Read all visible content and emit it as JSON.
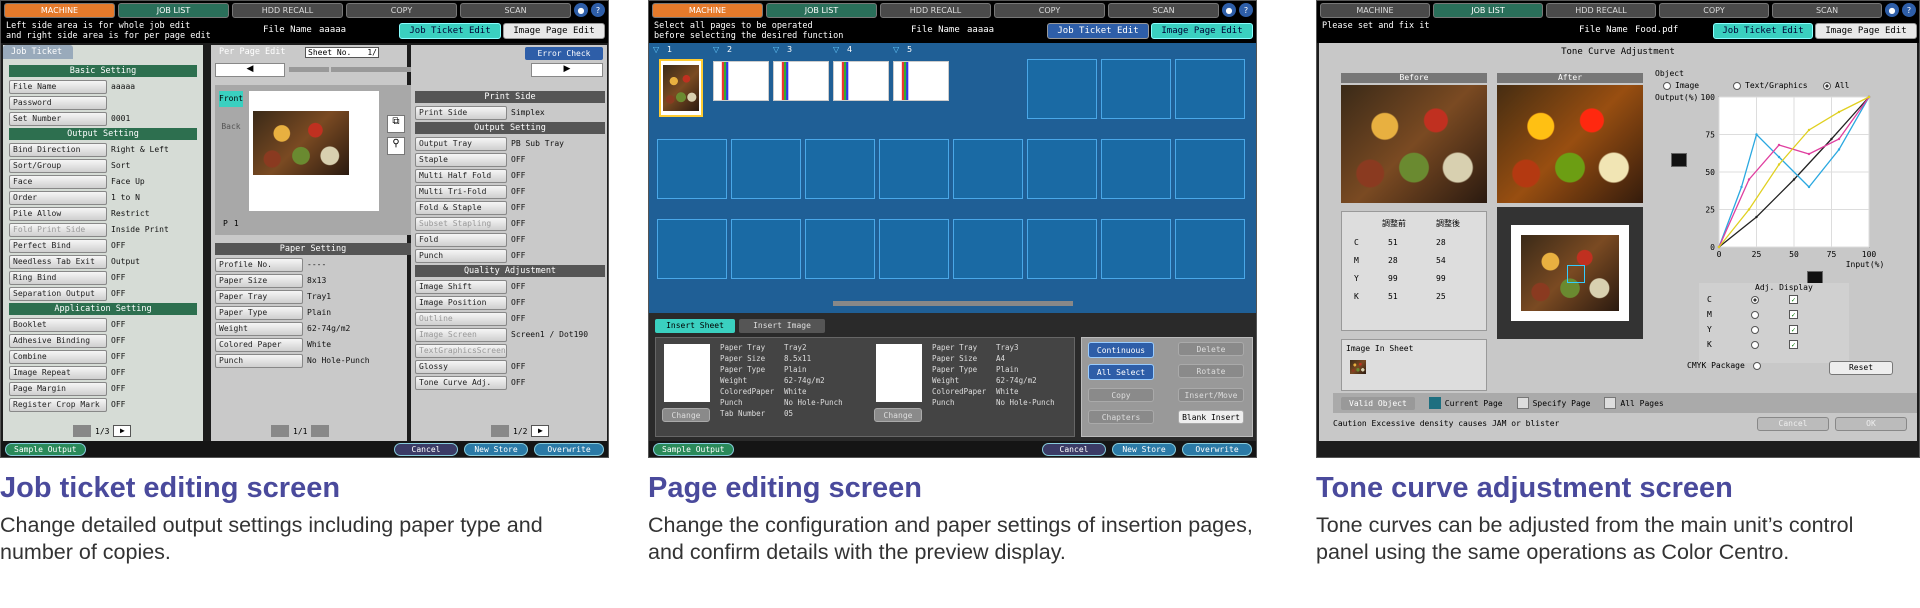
{
  "colors": {
    "machine_tab": "#e57a2b",
    "job_list_tab": "#2a6f5a",
    "accent_teal": "#3ad0c0",
    "section_green": "#2d6f4f",
    "caption_title": "#4a4a9c"
  },
  "topbar": {
    "machine": "MACHINE",
    "job_list": "JOB LIST",
    "hdd_recall": "HDD RECALL",
    "copy": "COPY",
    "scan": "SCAN",
    "help": "?"
  },
  "panel1": {
    "instr1": "Left side area is for whole job edit",
    "instr2": "and right side area is for per page edit",
    "file_name_label": "File Name",
    "file_name": "aaaaa",
    "tab_job_ticket": "Job Ticket Edit",
    "tab_image_page": "Image Page Edit",
    "job_ticket_tab": "Job Ticket",
    "per_page_edit": "Per Page Edit",
    "sheet_no_label": "Sheet No.",
    "sheet_no": "1/",
    "error_check": "Error Check",
    "front": "Front",
    "back": "Back",
    "page_label": "P",
    "page_num": "1",
    "basic_setting": "Basic Setting",
    "basic_rows": [
      {
        "label": "File Name",
        "value": "aaaaa"
      },
      {
        "label": "Password",
        "value": ""
      },
      {
        "label": "Set Number",
        "value": "0001"
      }
    ],
    "output_setting": "Output Setting",
    "output_rows": [
      {
        "label": "Bind Direction",
        "value": "Right & Left"
      },
      {
        "label": "Sort/Group",
        "value": "Sort"
      },
      {
        "label": "Face",
        "value": "Face Up"
      },
      {
        "label": "Order",
        "value": "1 to N"
      },
      {
        "label": "Pile Allow",
        "value": "Restrict"
      },
      {
        "label": "Fold Print Side",
        "value": "Inside Print"
      },
      {
        "label": "Perfect Bind",
        "value": "OFF"
      },
      {
        "label": "Needless Tab Exit",
        "value": "Output"
      },
      {
        "label": "Ring Bind",
        "value": "OFF"
      },
      {
        "label": "Separation Output",
        "value": "OFF"
      }
    ],
    "application_setting": "Application Setting",
    "app_rows": [
      {
        "label": "Booklet",
        "value": "OFF"
      },
      {
        "label": "Adhesive Binding",
        "value": "OFF"
      },
      {
        "label": "Combine",
        "value": "OFF"
      },
      {
        "label": "Image Repeat",
        "value": "OFF"
      },
      {
        "label": "Page Margin",
        "value": "OFF"
      },
      {
        "label": "Register Crop Mark",
        "value": "OFF"
      }
    ],
    "left_pager": "1/3",
    "paper_setting": "Paper Setting",
    "paper_rows": [
      {
        "label": "Profile No.",
        "value": "----"
      },
      {
        "label": "Paper Size",
        "value": "8x13"
      },
      {
        "label": "Paper Tray",
        "value": "Tray1"
      },
      {
        "label": "Paper Type",
        "value": "Plain"
      },
      {
        "label": "Weight",
        "value": "62-74g/m2"
      },
      {
        "label": "Colored Paper",
        "value": "White"
      },
      {
        "label": "Punch",
        "value": "No Hole-Punch"
      }
    ],
    "mid_pager": "1/1",
    "print_side": "Print Side",
    "print_rows": [
      {
        "label": "Print Side",
        "value": "Simplex"
      }
    ],
    "output_setting_r": "Output Setting",
    "output_r_rows": [
      {
        "label": "Output Tray",
        "value": "PB Sub Tray"
      },
      {
        "label": "Staple",
        "value": "OFF"
      },
      {
        "label": "Multi Half Fold",
        "value": "OFF"
      },
      {
        "label": "Multi Tri-Fold",
        "value": "OFF"
      },
      {
        "label": "Fold & Staple",
        "value": "OFF"
      },
      {
        "label": "Subset Stapling",
        "value": "OFF"
      },
      {
        "label": "Fold",
        "value": "OFF"
      },
      {
        "label": "Punch",
        "value": "OFF"
      }
    ],
    "quality_adjustment": "Quality Adjustment",
    "quality_rows": [
      {
        "label": "Image Shift",
        "value": "OFF"
      },
      {
        "label": "Image Position",
        "value": "OFF"
      },
      {
        "label": "Outline",
        "value": "OFF"
      },
      {
        "label": "Image Screen",
        "value": "Screen1 / Dot190"
      },
      {
        "label": "TextGraphicsScreen",
        "value": ""
      },
      {
        "label": "Glossy",
        "value": "OFF"
      },
      {
        "label": "Tone Curve Adj.",
        "value": "OFF"
      }
    ],
    "right_pager": "1/2",
    "sample_output": "Sample Output",
    "cancel": "Cancel",
    "new_store": "New Store",
    "overwrite": "Overwrite"
  },
  "panel2": {
    "instr1": "Select all pages to be operated",
    "instr2": "before selecting the desired function",
    "file_name_label": "File Name",
    "file_name": "aaaaa",
    "tab_job_ticket": "Job Ticket Edit",
    "tab_image_page": "Image Page Edit",
    "page_numbers": [
      "1",
      "2",
      "3",
      "4",
      "5"
    ],
    "insert_sheet": "Insert Sheet",
    "insert_image": "Insert Image",
    "sheet_a": [
      {
        "label": "Paper Tray",
        "value": "Tray2"
      },
      {
        "label": "Paper Size",
        "value": "8.5x11"
      },
      {
        "label": "Paper Type",
        "value": "Plain"
      },
      {
        "label": "Weight",
        "value": "62-74g/m2"
      },
      {
        "label": "ColoredPaper",
        "value": "White"
      },
      {
        "label": "Punch",
        "value": "No Hole-Punch"
      },
      {
        "label": "Tab Number",
        "value": "05"
      }
    ],
    "sheet_b": [
      {
        "label": "Paper Tray",
        "value": "Tray3"
      },
      {
        "label": "Paper Size",
        "value": "A4"
      },
      {
        "label": "Paper Type",
        "value": "Plain"
      },
      {
        "label": "Weight",
        "value": "62-74g/m2"
      },
      {
        "label": "ColoredPaper",
        "value": "White"
      },
      {
        "label": "Punch",
        "value": "No Hole-Punch"
      }
    ],
    "change": "Change",
    "continuous": "Continuous",
    "all_select": "All Select",
    "copy": "Copy",
    "chapters": "Chapters",
    "delete": "Delete",
    "rotate": "Rotate",
    "insert_move": "Insert/Move",
    "blank_insert": "Blank Insert",
    "sample_output": "Sample Output",
    "cancel": "Cancel",
    "new_store": "New Store",
    "overwrite": "Overwrite"
  },
  "panel3": {
    "instr": "Please set and fix it",
    "file_name_label": "File Name",
    "file_name": "Food.pdf",
    "tab_job_ticket": "Job Ticket Edit",
    "tab_image_page": "Image Page Edit",
    "title": "Tone Curve Adjustment",
    "before": "Before",
    "after": "After",
    "object_label": "Object",
    "obj_image": "Image",
    "obj_text": "Text/Graphics",
    "obj_all": "All",
    "output_label": "Output(%)",
    "input_label": "Input(%)",
    "y_ticks": [
      "100",
      "75",
      "50",
      "25",
      "0"
    ],
    "x_ticks": [
      "0",
      "25",
      "50",
      "75",
      "100"
    ],
    "table_head_before": "調整前",
    "table_head_after": "調整後",
    "table": [
      {
        "ch": "C",
        "before": "51",
        "after": "28"
      },
      {
        "ch": "M",
        "before": "28",
        "after": "54"
      },
      {
        "ch": "Y",
        "before": "99",
        "after": "99"
      },
      {
        "ch": "K",
        "before": "51",
        "after": "25"
      }
    ],
    "image_in_sheet": "Image In Sheet",
    "adj_display": "Adj. Display",
    "adj_channels": [
      "C",
      "M",
      "Y",
      "K"
    ],
    "cmyk_package": "CMYK Package",
    "reset": "Reset",
    "valid_object": "Valid Object",
    "current_page": "Current Page",
    "specify_page": "Specify Page",
    "all_pages": "All Pages",
    "caution": "Caution Excessive density causes JAM or blister",
    "cancel": "Cancel",
    "ok": "OK"
  },
  "chart_data": {
    "type": "line",
    "xlabel": "Input(%)",
    "ylabel": "Output(%)",
    "xlim": [
      0,
      100
    ],
    "ylim": [
      0,
      100
    ],
    "series": [
      {
        "color": "#222222",
        "x": [
          0,
          25,
          50,
          75,
          100
        ],
        "y": [
          0,
          20,
          45,
          72,
          100
        ]
      },
      {
        "color": "#2aa8e0",
        "x": [
          0,
          15,
          25,
          40,
          60,
          80,
          100
        ],
        "y": [
          0,
          40,
          75,
          60,
          40,
          65,
          100
        ]
      },
      {
        "color": "#e040a0",
        "x": [
          0,
          20,
          40,
          60,
          80,
          100
        ],
        "y": [
          0,
          45,
          68,
          62,
          72,
          100
        ]
      },
      {
        "color": "#e0d020",
        "x": [
          0,
          20,
          40,
          60,
          80,
          100
        ],
        "y": [
          0,
          25,
          55,
          78,
          90,
          100
        ]
      }
    ]
  },
  "captions": [
    {
      "title": "Job ticket editing screen",
      "body": "Change detailed output settings including paper type and number of copies."
    },
    {
      "title": "Page editing screen",
      "body": "Change the configuration and paper settings of insertion pages, and confirm details with the preview display."
    },
    {
      "title": "Tone curve adjustment screen",
      "body": "Tone curves can be adjusted from the main unit’s control panel using the same operations as Color Centro."
    }
  ]
}
